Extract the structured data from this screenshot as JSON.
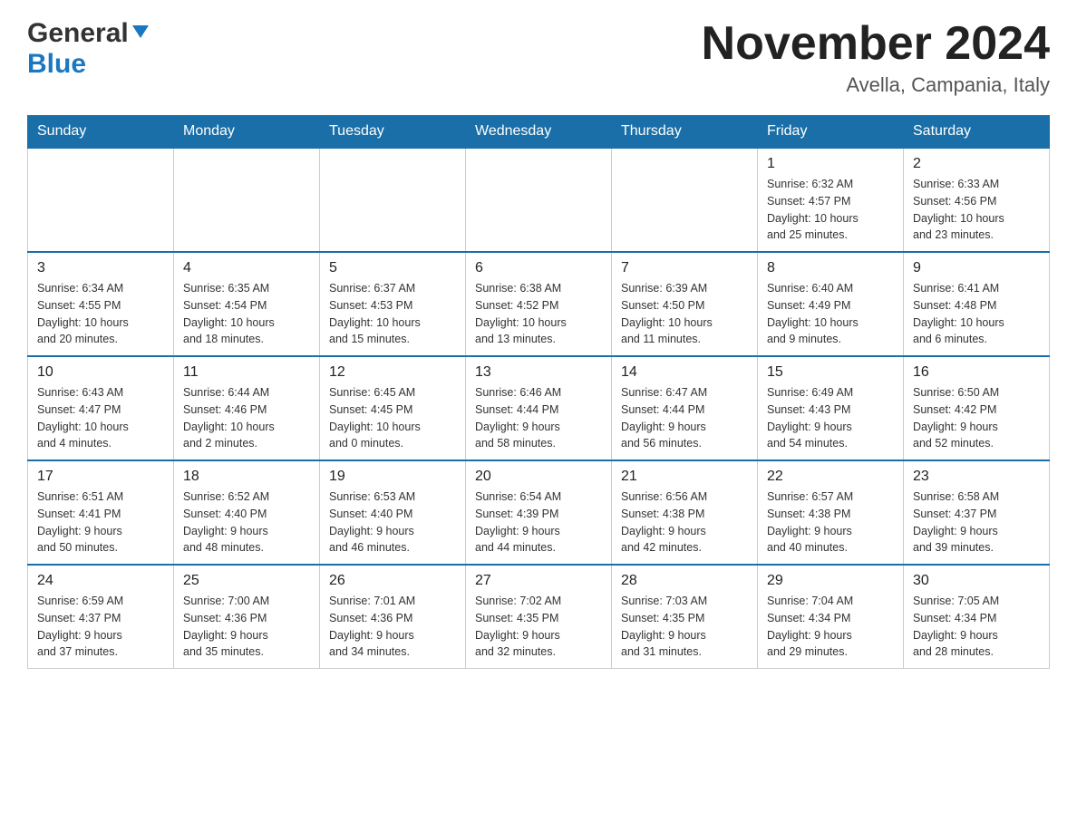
{
  "header": {
    "logo_general": "General",
    "logo_blue": "Blue",
    "month_title": "November 2024",
    "location": "Avella, Campania, Italy"
  },
  "days_of_week": [
    "Sunday",
    "Monday",
    "Tuesday",
    "Wednesday",
    "Thursday",
    "Friday",
    "Saturday"
  ],
  "weeks": [
    {
      "days": [
        {
          "num": "",
          "info": ""
        },
        {
          "num": "",
          "info": ""
        },
        {
          "num": "",
          "info": ""
        },
        {
          "num": "",
          "info": ""
        },
        {
          "num": "",
          "info": ""
        },
        {
          "num": "1",
          "info": "Sunrise: 6:32 AM\nSunset: 4:57 PM\nDaylight: 10 hours\nand 25 minutes."
        },
        {
          "num": "2",
          "info": "Sunrise: 6:33 AM\nSunset: 4:56 PM\nDaylight: 10 hours\nand 23 minutes."
        }
      ]
    },
    {
      "days": [
        {
          "num": "3",
          "info": "Sunrise: 6:34 AM\nSunset: 4:55 PM\nDaylight: 10 hours\nand 20 minutes."
        },
        {
          "num": "4",
          "info": "Sunrise: 6:35 AM\nSunset: 4:54 PM\nDaylight: 10 hours\nand 18 minutes."
        },
        {
          "num": "5",
          "info": "Sunrise: 6:37 AM\nSunset: 4:53 PM\nDaylight: 10 hours\nand 15 minutes."
        },
        {
          "num": "6",
          "info": "Sunrise: 6:38 AM\nSunset: 4:52 PM\nDaylight: 10 hours\nand 13 minutes."
        },
        {
          "num": "7",
          "info": "Sunrise: 6:39 AM\nSunset: 4:50 PM\nDaylight: 10 hours\nand 11 minutes."
        },
        {
          "num": "8",
          "info": "Sunrise: 6:40 AM\nSunset: 4:49 PM\nDaylight: 10 hours\nand 9 minutes."
        },
        {
          "num": "9",
          "info": "Sunrise: 6:41 AM\nSunset: 4:48 PM\nDaylight: 10 hours\nand 6 minutes."
        }
      ]
    },
    {
      "days": [
        {
          "num": "10",
          "info": "Sunrise: 6:43 AM\nSunset: 4:47 PM\nDaylight: 10 hours\nand 4 minutes."
        },
        {
          "num": "11",
          "info": "Sunrise: 6:44 AM\nSunset: 4:46 PM\nDaylight: 10 hours\nand 2 minutes."
        },
        {
          "num": "12",
          "info": "Sunrise: 6:45 AM\nSunset: 4:45 PM\nDaylight: 10 hours\nand 0 minutes."
        },
        {
          "num": "13",
          "info": "Sunrise: 6:46 AM\nSunset: 4:44 PM\nDaylight: 9 hours\nand 58 minutes."
        },
        {
          "num": "14",
          "info": "Sunrise: 6:47 AM\nSunset: 4:44 PM\nDaylight: 9 hours\nand 56 minutes."
        },
        {
          "num": "15",
          "info": "Sunrise: 6:49 AM\nSunset: 4:43 PM\nDaylight: 9 hours\nand 54 minutes."
        },
        {
          "num": "16",
          "info": "Sunrise: 6:50 AM\nSunset: 4:42 PM\nDaylight: 9 hours\nand 52 minutes."
        }
      ]
    },
    {
      "days": [
        {
          "num": "17",
          "info": "Sunrise: 6:51 AM\nSunset: 4:41 PM\nDaylight: 9 hours\nand 50 minutes."
        },
        {
          "num": "18",
          "info": "Sunrise: 6:52 AM\nSunset: 4:40 PM\nDaylight: 9 hours\nand 48 minutes."
        },
        {
          "num": "19",
          "info": "Sunrise: 6:53 AM\nSunset: 4:40 PM\nDaylight: 9 hours\nand 46 minutes."
        },
        {
          "num": "20",
          "info": "Sunrise: 6:54 AM\nSunset: 4:39 PM\nDaylight: 9 hours\nand 44 minutes."
        },
        {
          "num": "21",
          "info": "Sunrise: 6:56 AM\nSunset: 4:38 PM\nDaylight: 9 hours\nand 42 minutes."
        },
        {
          "num": "22",
          "info": "Sunrise: 6:57 AM\nSunset: 4:38 PM\nDaylight: 9 hours\nand 40 minutes."
        },
        {
          "num": "23",
          "info": "Sunrise: 6:58 AM\nSunset: 4:37 PM\nDaylight: 9 hours\nand 39 minutes."
        }
      ]
    },
    {
      "days": [
        {
          "num": "24",
          "info": "Sunrise: 6:59 AM\nSunset: 4:37 PM\nDaylight: 9 hours\nand 37 minutes."
        },
        {
          "num": "25",
          "info": "Sunrise: 7:00 AM\nSunset: 4:36 PM\nDaylight: 9 hours\nand 35 minutes."
        },
        {
          "num": "26",
          "info": "Sunrise: 7:01 AM\nSunset: 4:36 PM\nDaylight: 9 hours\nand 34 minutes."
        },
        {
          "num": "27",
          "info": "Sunrise: 7:02 AM\nSunset: 4:35 PM\nDaylight: 9 hours\nand 32 minutes."
        },
        {
          "num": "28",
          "info": "Sunrise: 7:03 AM\nSunset: 4:35 PM\nDaylight: 9 hours\nand 31 minutes."
        },
        {
          "num": "29",
          "info": "Sunrise: 7:04 AM\nSunset: 4:34 PM\nDaylight: 9 hours\nand 29 minutes."
        },
        {
          "num": "30",
          "info": "Sunrise: 7:05 AM\nSunset: 4:34 PM\nDaylight: 9 hours\nand 28 minutes."
        }
      ]
    }
  ]
}
